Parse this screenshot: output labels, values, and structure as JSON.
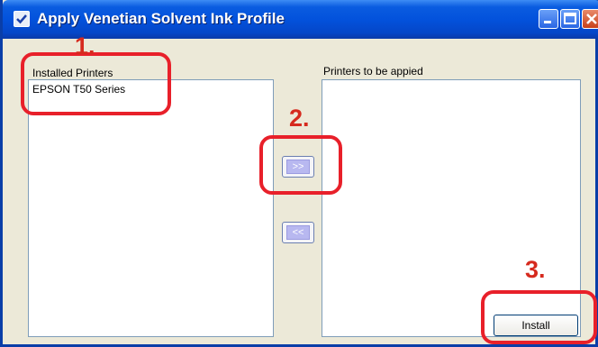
{
  "window": {
    "title": "Apply Venetian Solvent Ink Profile",
    "titlebar_color": "#0352dc",
    "face_color": "#ece9d8"
  },
  "installed_printers": {
    "label": "Installed Printers",
    "items": [
      "EPSON T50 Series"
    ]
  },
  "target_printers": {
    "label": "Printers to be appied",
    "items": []
  },
  "buttons": {
    "add": ">>",
    "remove": "<<",
    "install": "Install"
  },
  "annotations": {
    "color": "#e8202a",
    "steps": [
      "1.",
      "2.",
      "3."
    ]
  },
  "icons": {
    "app": "check-icon",
    "minimize": "minimize-icon",
    "maximize": "maximize-icon",
    "close": "close-icon"
  }
}
